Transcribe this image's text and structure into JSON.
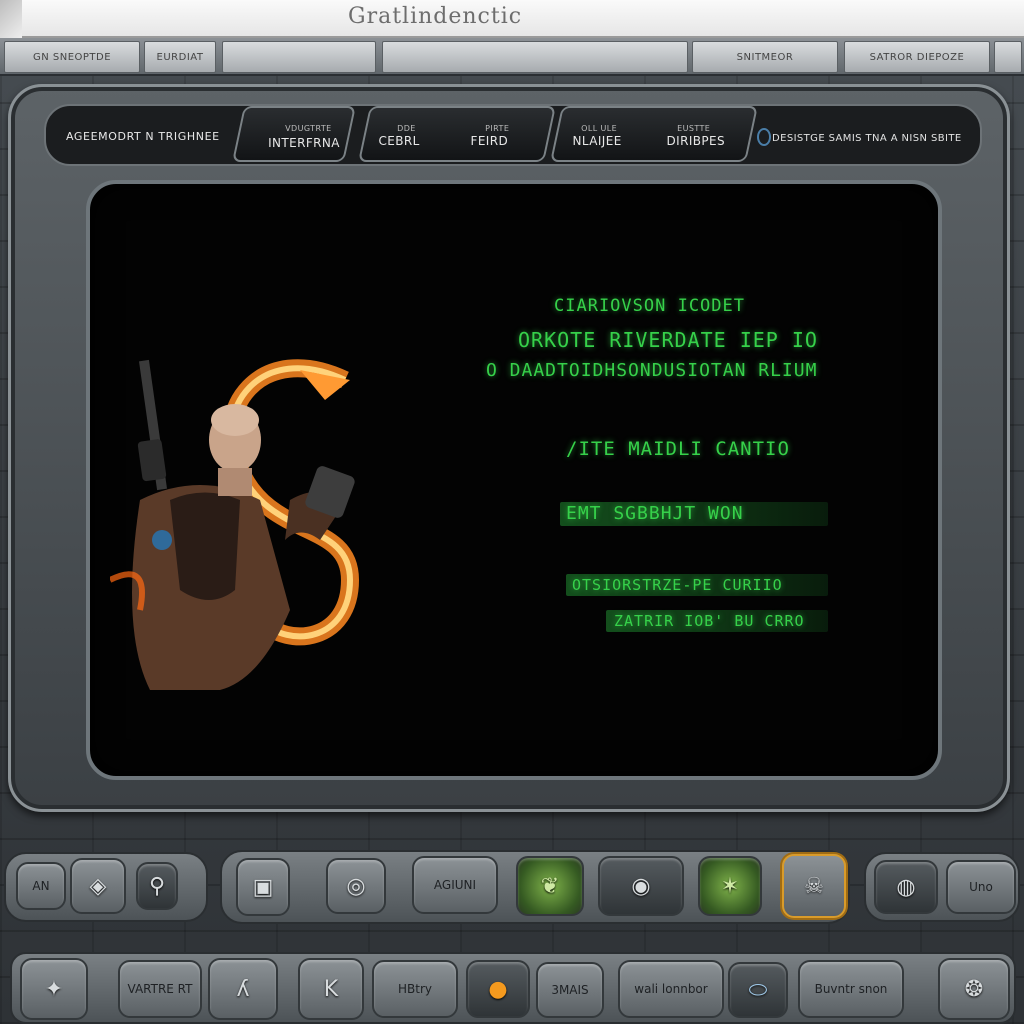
{
  "window": {
    "title": "Gratlindenctic"
  },
  "menu": {
    "tabs": [
      {
        "label": "GN SNEOPTDE"
      },
      {
        "label": "EURDIAT"
      },
      {
        "label": ""
      },
      {
        "label": ""
      },
      {
        "label": "SNITMEOR"
      },
      {
        "label": "SATROR DIEPOZE"
      }
    ]
  },
  "stats": {
    "left_label": "AGEEMODRT N TRIGHNEE",
    "pills": [
      {
        "small": "VDUGTRTE",
        "value": "INTERFRNA"
      },
      {
        "small": "DDE",
        "value": "CEBRL"
      },
      {
        "small": "PIRTE",
        "value": "FEIRD"
      },
      {
        "small": "OLL ULE",
        "value": "NLAIJEE"
      },
      {
        "small": "EUSTTE",
        "value": "DIRIBPES"
      }
    ],
    "right_label": "DESISTGE SAMIS TNA A NISN SBITE"
  },
  "screen": {
    "line1": "CIARIOVSON ICODET",
    "line2": "ORKOTE RIVERDATE IEP IO",
    "line3": "O DAADTOIDHSONDUSIOTAN RLIUM",
    "line4": "/ITE MAIDLI CANTIO",
    "line5": "EMT SGBBHJT  WON",
    "line6": "OTSIORSTRZE-PE CURIIO",
    "line7": "ZATRIR IOB' BU CRRO"
  },
  "controls": {
    "row1": [
      {
        "label": "AN",
        "icon": "gear-icon"
      },
      {
        "label": "",
        "icon": "map-icon"
      },
      {
        "label": "",
        "icon": "lock-icon"
      },
      {
        "label": "",
        "icon": "id-icon"
      },
      {
        "label": "",
        "icon": "target-icon"
      },
      {
        "label": "AGIUNI",
        "icon": ""
      },
      {
        "label": "",
        "icon": "leaf-icon"
      },
      {
        "label": "",
        "icon": "radar-icon"
      },
      {
        "label": "",
        "icon": "bug-icon"
      },
      {
        "label": "",
        "icon": "skull-icon"
      },
      {
        "label": "Uno",
        "icon": "eye-icon"
      }
    ],
    "row2": [
      {
        "label": "",
        "icon": "dragon-icon"
      },
      {
        "label": "VARTRE RT",
        "icon": ""
      },
      {
        "label": "",
        "icon": "wolf-icon"
      },
      {
        "label": "",
        "icon": "helmet-icon"
      },
      {
        "label": "HBtry",
        "icon": ""
      },
      {
        "label": "",
        "icon": "orb-icon"
      },
      {
        "label": "3MAIS",
        "icon": ""
      },
      {
        "label": "wali lonnbor",
        "icon": ""
      },
      {
        "label": "",
        "icon": "gem-icon"
      },
      {
        "label": "Buvntr snon",
        "icon": ""
      },
      {
        "label": "",
        "icon": "emblem-icon"
      }
    ]
  },
  "colors": {
    "terminal_green": "#36d14a",
    "accent_orange": "#d99b2a",
    "frame": "#6e767b"
  }
}
